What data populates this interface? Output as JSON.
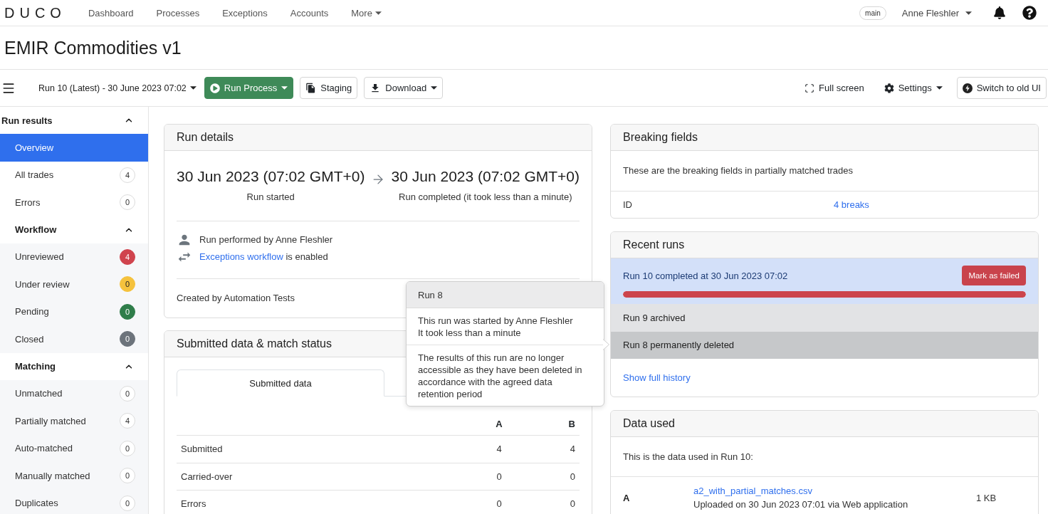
{
  "nav": {
    "logo": "DUCO",
    "links": [
      {
        "label": "Dashboard",
        "dropdown": false
      },
      {
        "label": "Processes",
        "dropdown": false
      },
      {
        "label": "Exceptions",
        "dropdown": false
      },
      {
        "label": "Accounts",
        "dropdown": false
      },
      {
        "label": "More",
        "dropdown": true
      }
    ],
    "branch": "main",
    "user": {
      "name": "Anne Fleshler",
      "dropdown": true
    }
  },
  "page_title": "EMIR Commodities v1",
  "toolbar": {
    "run_selector": "Run 10 (Latest) - 30 June 2023 07:02",
    "left_buttons": [
      {
        "label": "Run Process",
        "kind": "primary",
        "dropdown": true
      },
      {
        "label": "Staging",
        "kind": "outline",
        "dropdown": false
      },
      {
        "label": "Download",
        "kind": "outline",
        "dropdown": true
      }
    ],
    "right_buttons": [
      {
        "label": "Full screen",
        "kind": "plain",
        "dropdown": false
      },
      {
        "label": "Settings",
        "kind": "plain",
        "dropdown": true
      },
      {
        "label": "Switch to old UI",
        "kind": "outline",
        "dropdown": false
      }
    ]
  },
  "sidebar": {
    "sections": [
      {
        "title": "Run results",
        "kind": "plain",
        "expanded": true,
        "items": [
          {
            "label": "Overview",
            "selected": true
          },
          {
            "label": "All trades",
            "count": "4",
            "selected": false
          },
          {
            "label": "Errors",
            "count": "0",
            "selected": false
          }
        ]
      },
      {
        "title": "Workflow",
        "kind": "shaded",
        "expanded": true,
        "items": [
          {
            "label": "Unreviewed",
            "count": "4",
            "color": "#d0434d",
            "selected": false
          },
          {
            "label": "Under review",
            "count": "0",
            "color": "#f5c23d",
            "selected": false
          },
          {
            "label": "Pending",
            "count": "0",
            "color": "#2f7d4a",
            "selected": false
          },
          {
            "label": "Closed",
            "count": "0",
            "color": "#6c737b",
            "selected": false
          }
        ]
      },
      {
        "title": "Matching",
        "kind": "shaded",
        "expanded": true,
        "items": [
          {
            "label": "Unmatched",
            "count": "0",
            "selected": false
          },
          {
            "label": "Partially matched",
            "count": "4",
            "selected": false
          },
          {
            "label": "Auto-matched",
            "count": "0",
            "selected": false
          },
          {
            "label": "Manually matched",
            "count": "0",
            "selected": false
          },
          {
            "label": "Duplicates",
            "count": "0",
            "selected": false
          }
        ]
      }
    ]
  },
  "run_details": {
    "title": "Run details",
    "start": {
      "time": "30 Jun 2023 (07:02 GMT+0)",
      "label": "Run started"
    },
    "end": {
      "time": "30 Jun 2023 (07:02 GMT+0)",
      "label": "Run completed (it took less than a minute)"
    },
    "performed_by": "Run performed by Anne Fleshler",
    "workflow": {
      "link": "Exceptions workflow",
      "rest": "is enabled"
    },
    "created_by": "Created by Automation Tests"
  },
  "submitted": {
    "title": "Submitted data & match status",
    "tabs": [
      {
        "label": "Submitted data",
        "selected": true
      }
    ],
    "columns": [
      "A",
      "B"
    ],
    "rows": [
      {
        "label": "Submitted",
        "values": [
          "4",
          "4"
        ]
      },
      {
        "label": "Carried-over",
        "values": [
          "0",
          "0"
        ]
      },
      {
        "label": "Errors",
        "values": [
          "0",
          "0"
        ]
      }
    ]
  },
  "popover": {
    "title": "Run 8",
    "lines": [
      "This run was started by Anne Fleshler",
      "It took less than a minute"
    ],
    "note": "The results of this run are no longer accessible as they have been deleted in accordance with the agreed data retention period"
  },
  "breaking_fields": {
    "title": "Breaking fields",
    "description": "These are the breaking fields in partially matched trades",
    "rows": [
      {
        "field": "ID",
        "breaks": "4 breaks"
      }
    ]
  },
  "recent_runs": {
    "title": "Recent runs",
    "runs": [
      {
        "text": "Run 10 completed at 30 Jun 2023 07:02",
        "kind": "completed",
        "hovered": false,
        "action": "Mark as failed",
        "level": 1
      },
      {
        "text": "Run 9 archived",
        "kind": "archived",
        "hovered": false
      },
      {
        "text": "Run 8 permanently deleted",
        "kind": "deleted",
        "hovered": true
      }
    ],
    "history_link": "Show full history"
  },
  "data_used": {
    "title": "Data used",
    "description": "This is the data used in Run 10:",
    "files": [
      {
        "side": "A",
        "name": "a2_with_partial_matches.csv",
        "uploaded": "Uploaded on 30 Jun 2023 07:01 via Web application",
        "size": "1 KB"
      }
    ]
  }
}
